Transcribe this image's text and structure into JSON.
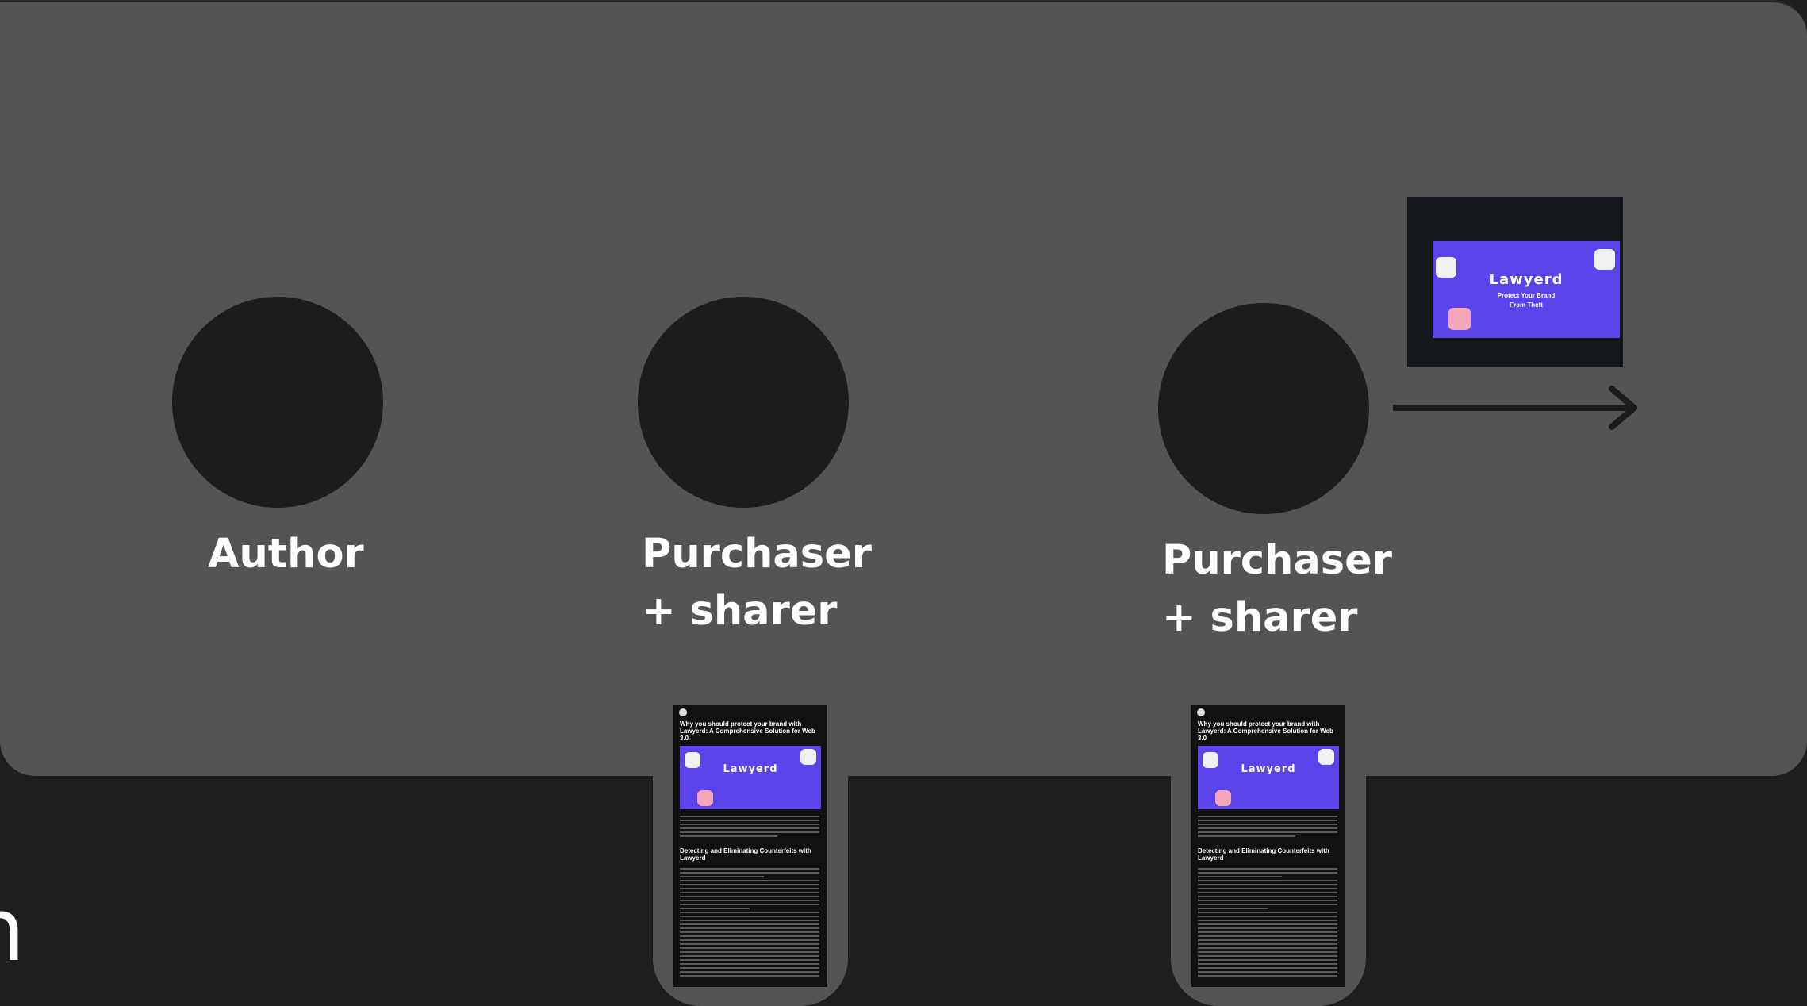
{
  "nodes": [
    {
      "id": "author",
      "lines": [
        "Author"
      ]
    },
    {
      "id": "purchaser-1",
      "lines": [
        "Purchaser",
        "+ sharer"
      ]
    },
    {
      "id": "purchaser-2",
      "lines": [
        "Purchaser",
        "+ sharer"
      ]
    }
  ],
  "social_post": {
    "brand": "Lawyerd",
    "tagline_1": "Protect Your Brand",
    "tagline_2": "From Theft"
  },
  "articles": [
    {
      "title": "Why you should protect your brand with Lawyerd: A Comprehensive Solution for Web 3.0",
      "brand": "Lawyerd",
      "section_heading": "Detecting and Eliminating Counterfeits with Lawyerd"
    },
    {
      "title": "Why you should protect your brand with Lawyerd: A Comprehensive Solution for Web 3.0",
      "brand": "Lawyerd",
      "section_heading": "Detecting and Eliminating Counterfeits with Lawyerd"
    }
  ],
  "colors": {
    "panel": "#545454",
    "background": "#1e1e1e",
    "node": "#1c1c1c",
    "banner": "#5a43e8"
  }
}
